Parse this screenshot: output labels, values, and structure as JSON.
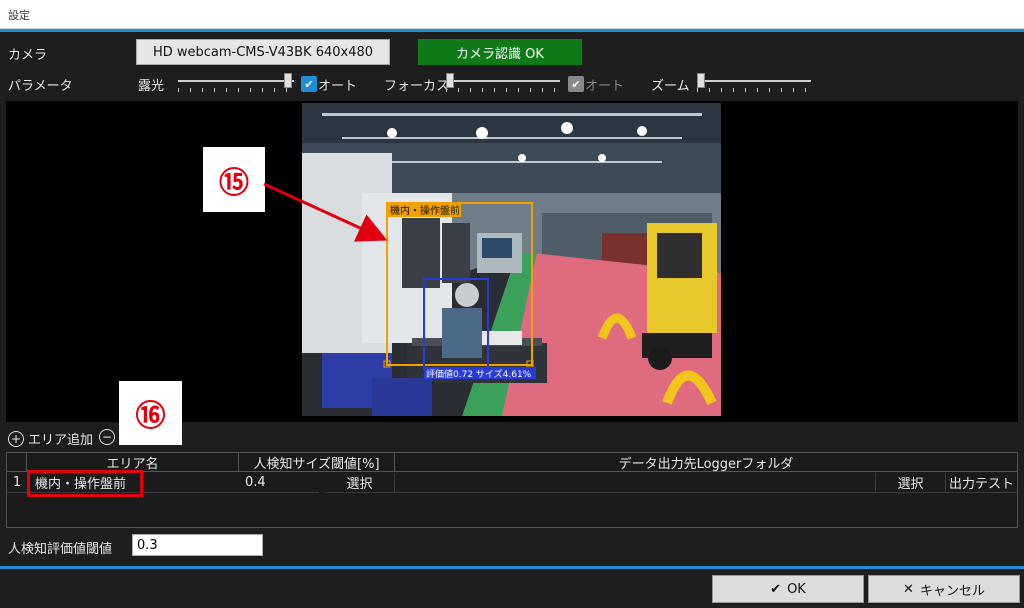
{
  "window": {
    "title": "設定"
  },
  "camera": {
    "label": "カメラ",
    "device": "HD webcam-CMS-V43BK  640x480",
    "status": "カメラ認識 OK",
    "status_color": "#0f7a17"
  },
  "parameters": {
    "label": "パラメータ",
    "exposure": {
      "label": "露光",
      "auto_label": "オート",
      "auto_checked": true,
      "level": 0.98
    },
    "focus": {
      "label": "フォーカス",
      "auto_label": "オート",
      "auto_checked": true,
      "auto_enabled": false,
      "level": 0.0
    },
    "zoom": {
      "label": "ズーム",
      "level": 0.0
    }
  },
  "preview": {
    "area_label": "機内・操作盤前",
    "detection_text": "評価値0.72 サイズ4.61%",
    "callout_15": "⑮"
  },
  "area_toolbar": {
    "add_label": "エリア追加",
    "callout_16": "⑯"
  },
  "table": {
    "headers": [
      "エリア名",
      "人検知サイズ閾値[%]",
      "データ出力先Loggerフォルダ"
    ],
    "rows": [
      {
        "index": "1",
        "name": "機内・操作盤前",
        "threshold": "0.4",
        "select1": "選択",
        "select2": "選択",
        "output_test": "出力テスト"
      }
    ]
  },
  "eval_threshold": {
    "label": "人検知評価値閾値",
    "value": "0.3"
  },
  "footer": {
    "ok_label": "OK",
    "cancel_label": "キャンセル"
  },
  "colors": {
    "accent": "#1e8fd6",
    "highlight": "#e00010",
    "detect_box": "#f0a000",
    "person_box": "#2a3cd8"
  }
}
